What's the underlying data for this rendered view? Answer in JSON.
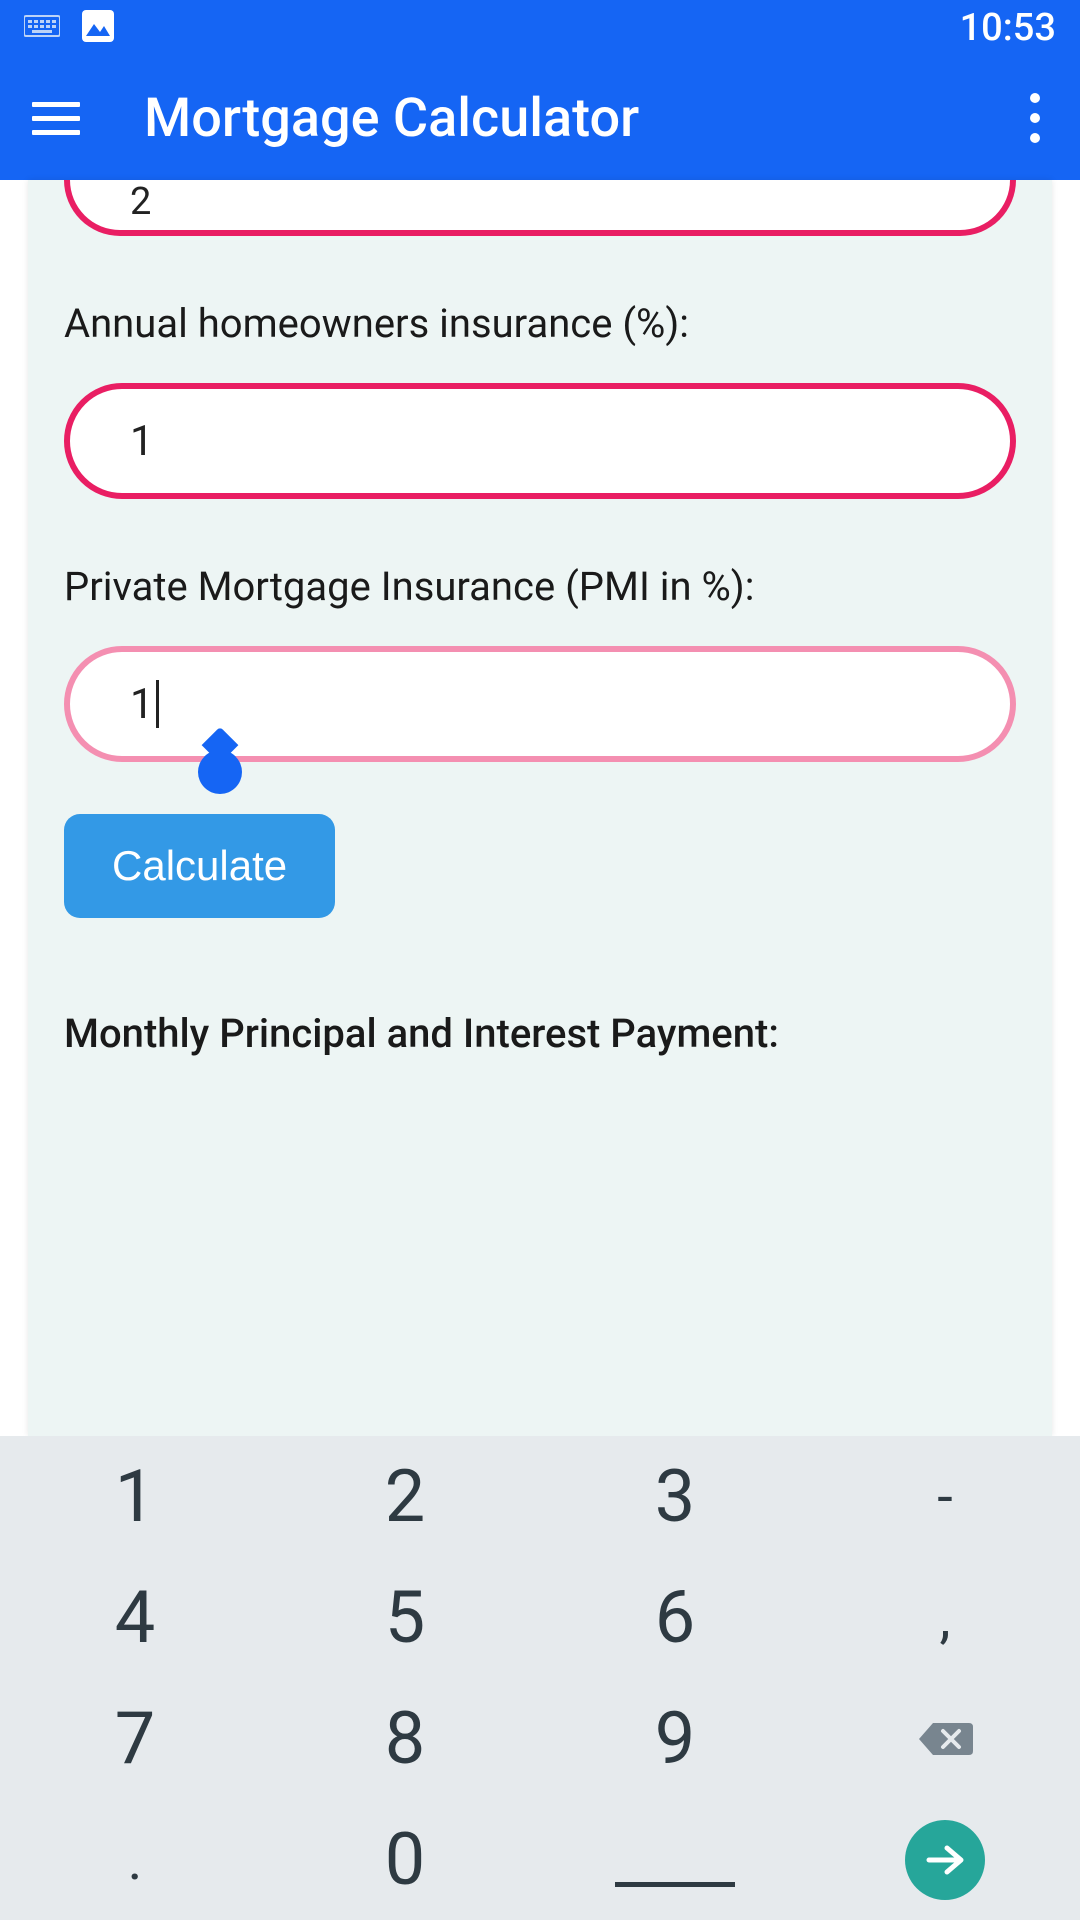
{
  "status": {
    "time": "10:53"
  },
  "appbar": {
    "title": "Mortgage Calculator"
  },
  "form": {
    "partial_field_value": "2",
    "insurance_label": "Annual homeowners insurance (%):",
    "insurance_value": "1",
    "pmi_label": "Private Mortgage Insurance (PMI in %):",
    "pmi_value": "1",
    "calculate_label": "Calculate",
    "result_label": "Monthly Principal and Interest Payment:"
  },
  "keyboard": {
    "rows": [
      [
        "1",
        "2",
        "3",
        "-"
      ],
      [
        "4",
        "5",
        "6",
        ","
      ],
      [
        "7",
        "8",
        "9",
        "backspace"
      ],
      [
        ".",
        "0",
        "space",
        "enter"
      ]
    ]
  }
}
